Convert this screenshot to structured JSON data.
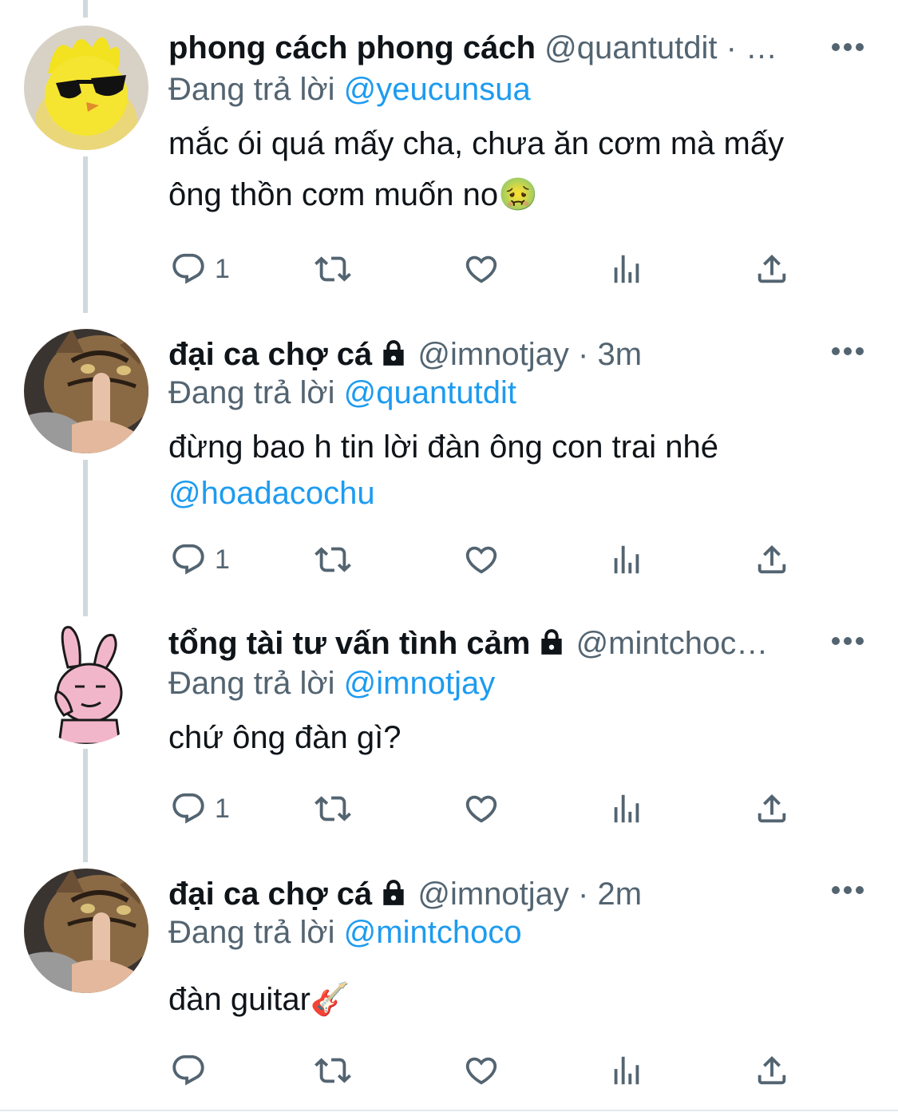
{
  "reply_prefix": "Đang trả lời",
  "colors": {
    "text": "#0f1419",
    "secondary": "#536471",
    "link": "#1d9bf0",
    "thread_line": "#cfd9de"
  },
  "tweets": [
    {
      "name": "phong cách phong cách",
      "handle": "@quantutdit",
      "meta": " · …",
      "protected": false,
      "reply_to": "@yeucunsua",
      "text_line1": "mắc ói quá mấy cha, chưa ăn cơm mà mấy",
      "text_line2": "ông thồn cơm muốn no🤢",
      "mention": "",
      "reply_count": "1",
      "avatar_icon": "sunglasses-chick-avatar"
    },
    {
      "name": "đại ca chợ cá",
      "handle": "@imnotjay",
      "meta": " · 3m",
      "protected": true,
      "reply_to": "@quantutdit",
      "text_line1": "đừng bao h tin lời đàn ông con trai nhé",
      "text_line2": "",
      "mention": "@hoadacochu",
      "reply_count": "1",
      "avatar_icon": "cat-shush-avatar"
    },
    {
      "name": "tổng tài tư vấn tình cảm",
      "handle": "@mintchoc…",
      "meta": "",
      "protected": true,
      "reply_to": "@imnotjay",
      "text_line1": "chứ ông đàn gì?",
      "text_line2": "",
      "mention": "",
      "reply_count": "1",
      "avatar_icon": "pink-bunny-avatar"
    },
    {
      "name": "đại ca chợ cá",
      "handle": "@imnotjay",
      "meta": " · 2m",
      "protected": true,
      "reply_to": "@mintchoco",
      "text_line1": "đàn guitar🎸",
      "text_line2": "",
      "mention": "",
      "reply_count": "",
      "avatar_icon": "cat-shush-avatar"
    }
  ]
}
